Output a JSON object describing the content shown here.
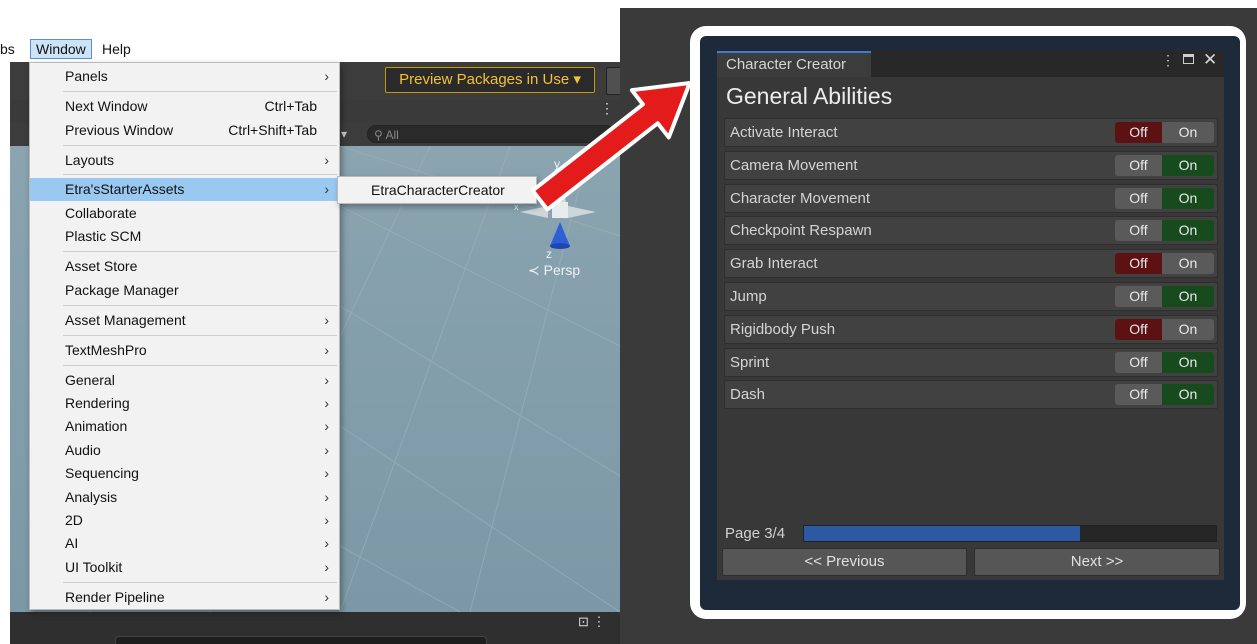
{
  "menubar": {
    "prev_item": "bs",
    "window": "Window",
    "help": "Help"
  },
  "toolbar": {
    "preview_packages": "Preview Packages in Use ▾"
  },
  "scene": {
    "search_placeholder": "All",
    "persp_label": "≺ Persp",
    "axis_y": "y",
    "axis_z": "z",
    "axis_x": "x"
  },
  "window_menu": {
    "items": [
      {
        "label": "Panels",
        "shortcut": "",
        "has_submenu": true
      },
      {
        "label": "Next Window",
        "shortcut": "Ctrl+Tab",
        "has_submenu": false
      },
      {
        "label": "Previous Window",
        "shortcut": "Ctrl+Shift+Tab",
        "has_submenu": false
      },
      {
        "label": "Layouts",
        "shortcut": "",
        "has_submenu": true
      },
      {
        "label": "Etra'sStarterAssets",
        "shortcut": "",
        "has_submenu": true,
        "highlighted": true
      },
      {
        "label": "Collaborate",
        "shortcut": "",
        "has_submenu": false
      },
      {
        "label": "Plastic SCM",
        "shortcut": "",
        "has_submenu": false
      },
      {
        "label": "Asset Store",
        "shortcut": "",
        "has_submenu": false
      },
      {
        "label": "Package Manager",
        "shortcut": "",
        "has_submenu": false
      },
      {
        "label": "Asset Management",
        "shortcut": "",
        "has_submenu": true
      },
      {
        "label": "TextMeshPro",
        "shortcut": "",
        "has_submenu": true
      },
      {
        "label": "General",
        "shortcut": "",
        "has_submenu": true
      },
      {
        "label": "Rendering",
        "shortcut": "",
        "has_submenu": true
      },
      {
        "label": "Animation",
        "shortcut": "",
        "has_submenu": true
      },
      {
        "label": "Audio",
        "shortcut": "",
        "has_submenu": true
      },
      {
        "label": "Sequencing",
        "shortcut": "",
        "has_submenu": true
      },
      {
        "label": "Analysis",
        "shortcut": "",
        "has_submenu": true
      },
      {
        "label": "2D",
        "shortcut": "",
        "has_submenu": true
      },
      {
        "label": "AI",
        "shortcut": "",
        "has_submenu": true
      },
      {
        "label": "UI Toolkit",
        "shortcut": "",
        "has_submenu": true
      },
      {
        "label": "Render Pipeline",
        "shortcut": "",
        "has_submenu": true
      }
    ],
    "submenu_item": "EtraCharacterCreator",
    "arrow_glyph": "›"
  },
  "character_creator": {
    "tab_title": "Character Creator",
    "heading": "General Abilities",
    "off_label": "Off",
    "on_label": "On",
    "abilities": [
      {
        "label": "Activate Interact",
        "state": "off"
      },
      {
        "label": "Camera Movement",
        "state": "on"
      },
      {
        "label": "Character Movement",
        "state": "on"
      },
      {
        "label": "Checkpoint Respawn",
        "state": "on"
      },
      {
        "label": "Grab Interact",
        "state": "off"
      },
      {
        "label": "Jump",
        "state": "on"
      },
      {
        "label": "Rigidbody Push",
        "state": "off"
      },
      {
        "label": "Sprint",
        "state": "on"
      },
      {
        "label": "Dash",
        "state": "on"
      }
    ],
    "page_label": "Page 3/4",
    "progress_fraction": 0.67,
    "previous_button": "<< Previous",
    "next_button": "Next >>",
    "colors": {
      "off_active": "#5c1212",
      "on_active": "#174a1c",
      "progress": "#2b5aa3",
      "arrow": "#e31b1b"
    }
  }
}
